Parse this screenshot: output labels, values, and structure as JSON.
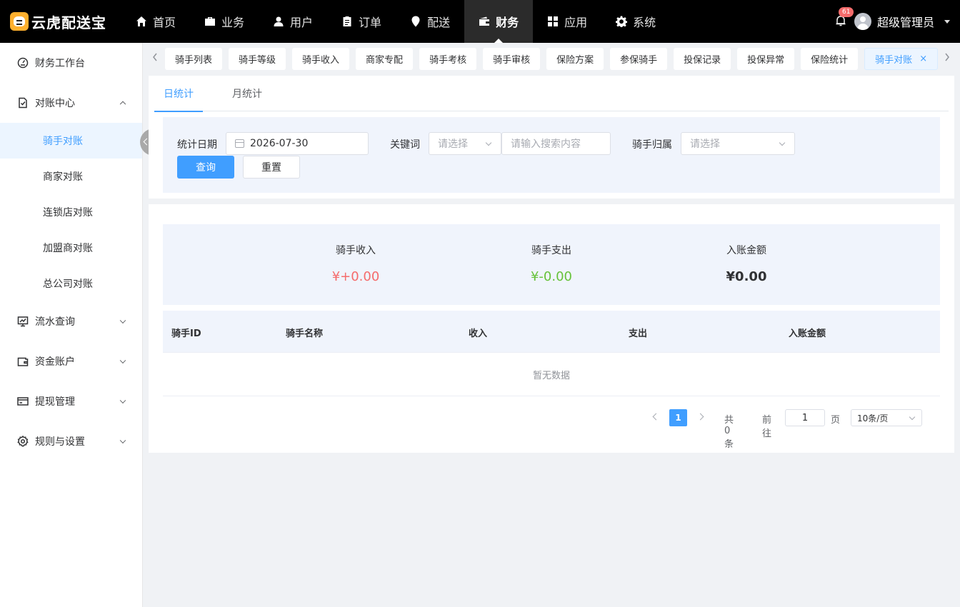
{
  "app": {
    "name": "云虎配送宝"
  },
  "topnav": [
    {
      "label": "首页",
      "icon": "home-icon"
    },
    {
      "label": "业务",
      "icon": "briefcase-icon"
    },
    {
      "label": "用户",
      "icon": "user-icon"
    },
    {
      "label": "订单",
      "icon": "clipboard-icon"
    },
    {
      "label": "配送",
      "icon": "location-pin-icon"
    },
    {
      "label": "财务",
      "icon": "wallet-icon",
      "active": true
    },
    {
      "label": "应用",
      "icon": "grid-icon"
    },
    {
      "label": "系统",
      "icon": "gear-icon"
    }
  ],
  "header": {
    "notification_count": "61",
    "username": "超级管理员"
  },
  "sidebar": {
    "workbench": "财务工作台",
    "reconcile": "对账中心",
    "reconcile_items": [
      "骑手对账",
      "商家对账",
      "连锁店对账",
      "加盟商对账",
      "总公司对账"
    ],
    "flow": "流水查询",
    "accounts": "资金账户",
    "withdraw": "提现管理",
    "rules": "规则与设置"
  },
  "tags": [
    "骑手列表",
    "骑手等级",
    "骑手收入",
    "商家专配",
    "骑手考核",
    "骑手审核",
    "保险方案",
    "参保骑手",
    "投保记录",
    "投保异常",
    "保险统计",
    "骑手对账"
  ],
  "tag_close": "×",
  "subtabs": [
    "日统计",
    "月统计"
  ],
  "filter": {
    "date_label": "统计日期",
    "date_value": "2026-07-30",
    "keyword_label": "关键词",
    "keyword_select_placeholder": "请选择",
    "keyword_input_placeholder": "请输入搜索内容",
    "belong_label": "骑手归属",
    "belong_placeholder": "请选择",
    "query_button": "查询",
    "reset_button": "重置"
  },
  "summary": {
    "income_label": "骑手收入",
    "income_value": "¥+0.00",
    "expense_label": "骑手支出",
    "expense_value": "¥-0.00",
    "entry_label": "入账金额",
    "entry_value": "¥0.00"
  },
  "table": {
    "columns": [
      "骑手ID",
      "骑手名称",
      "收入",
      "支出",
      "入账金额"
    ],
    "empty_text": "暂无数据"
  },
  "pagination": {
    "current_page": "1",
    "total_text": "共 0 条",
    "goto_label": "前往",
    "goto_value": "1",
    "page_suffix": "页",
    "page_size": "10条/页"
  },
  "colors": {
    "accent": "#409eff",
    "income": "#f56c6c",
    "expense": "#67c23a"
  }
}
